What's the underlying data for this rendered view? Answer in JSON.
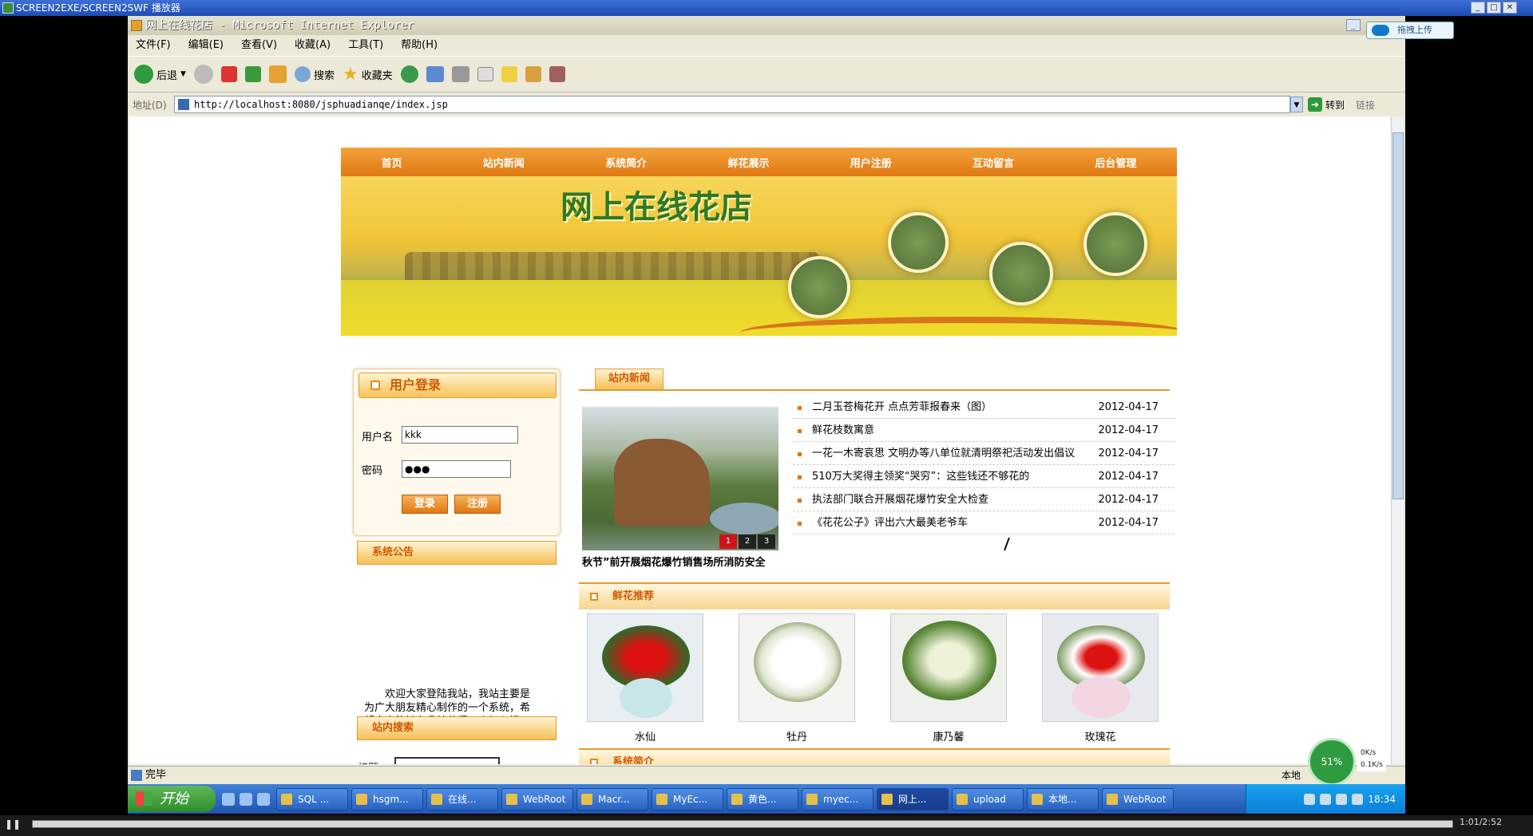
{
  "player": {
    "title": "SCREEN2EXE/SCREEN2SWF 播放器",
    "time": "1:01/2:52"
  },
  "ie": {
    "title": "网上在线花店 - Microsoft Internet Explorer",
    "upload_badge": "拖拽上传",
    "menu": [
      "文件(F)",
      "编辑(E)",
      "查看(V)",
      "收藏(A)",
      "工具(T)",
      "帮助(H)"
    ],
    "toolbar": {
      "back": "后退",
      "search": "搜索",
      "favorites": "收藏夹"
    },
    "address_label": "地址(D)",
    "address": "http://localhost:8080/jsphuadianqe/index.jsp",
    "go": "转到",
    "links": "链接",
    "status": "完毕",
    "zone": "本地",
    "speed": "51%",
    "net_up": "0K/s",
    "net_down": "0.1K/s"
  },
  "taskbar": {
    "start": "开始",
    "tasks": [
      "SQL ...",
      "hsgm...",
      "在线...",
      "WebRoot",
      "Macr...",
      "MyEc...",
      "黄色...",
      "myec...",
      "网上...",
      "upload",
      "本地...",
      "WebRoot"
    ],
    "clock": "18:34"
  },
  "site": {
    "nav": [
      "首页",
      "站内新闻",
      "系统简介",
      "鲜花展示",
      "用户注册",
      "互动留言",
      "后台管理"
    ],
    "banner_title": "网上在线花店",
    "login": {
      "title": "用户登录",
      "username_label": "用户名",
      "username_value": "kkk",
      "password_label": "密码",
      "password_value": "●●●",
      "login_btn": "登录",
      "register_btn": "注册"
    },
    "notice": {
      "title": "系统公告",
      "text": "欢迎大家登陆我站，我站主要是为广大朋友精心制作的一个系统，希望大家能够在我站获得一个好心情，"
    },
    "search": {
      "title": "站内搜索",
      "label": "标题"
    },
    "news": {
      "tab": "站内新闻",
      "caption": "秋节”前开展烟花爆竹销售场所消防安全",
      "slides": [
        "1",
        "2",
        "3"
      ],
      "items": [
        {
          "title": "二月玉苍梅花开 点点芳菲报春来（图）",
          "date": "2012-04-17"
        },
        {
          "title": "鲜花枝数寓意",
          "date": "2012-04-17"
        },
        {
          "title": "一花一木寄哀思 文明办等八单位就清明祭祀活动发出倡议",
          "date": "2012-04-17"
        },
        {
          "title": "510万大奖得主领奖“哭穷”：这些钱还不够花的",
          "date": "2012-04-17"
        },
        {
          "title": "执法部门联合开展烟花爆竹安全大检查",
          "date": "2012-04-17"
        },
        {
          "title": "《花花公子》评出六大最美老爷车",
          "date": "2012-04-17"
        }
      ]
    },
    "recommend": {
      "title": "鲜花推荐",
      "flowers": [
        "水仙",
        "牡丹",
        "康乃馨",
        "玫瑰花"
      ]
    },
    "intro_title": "系统简介"
  }
}
